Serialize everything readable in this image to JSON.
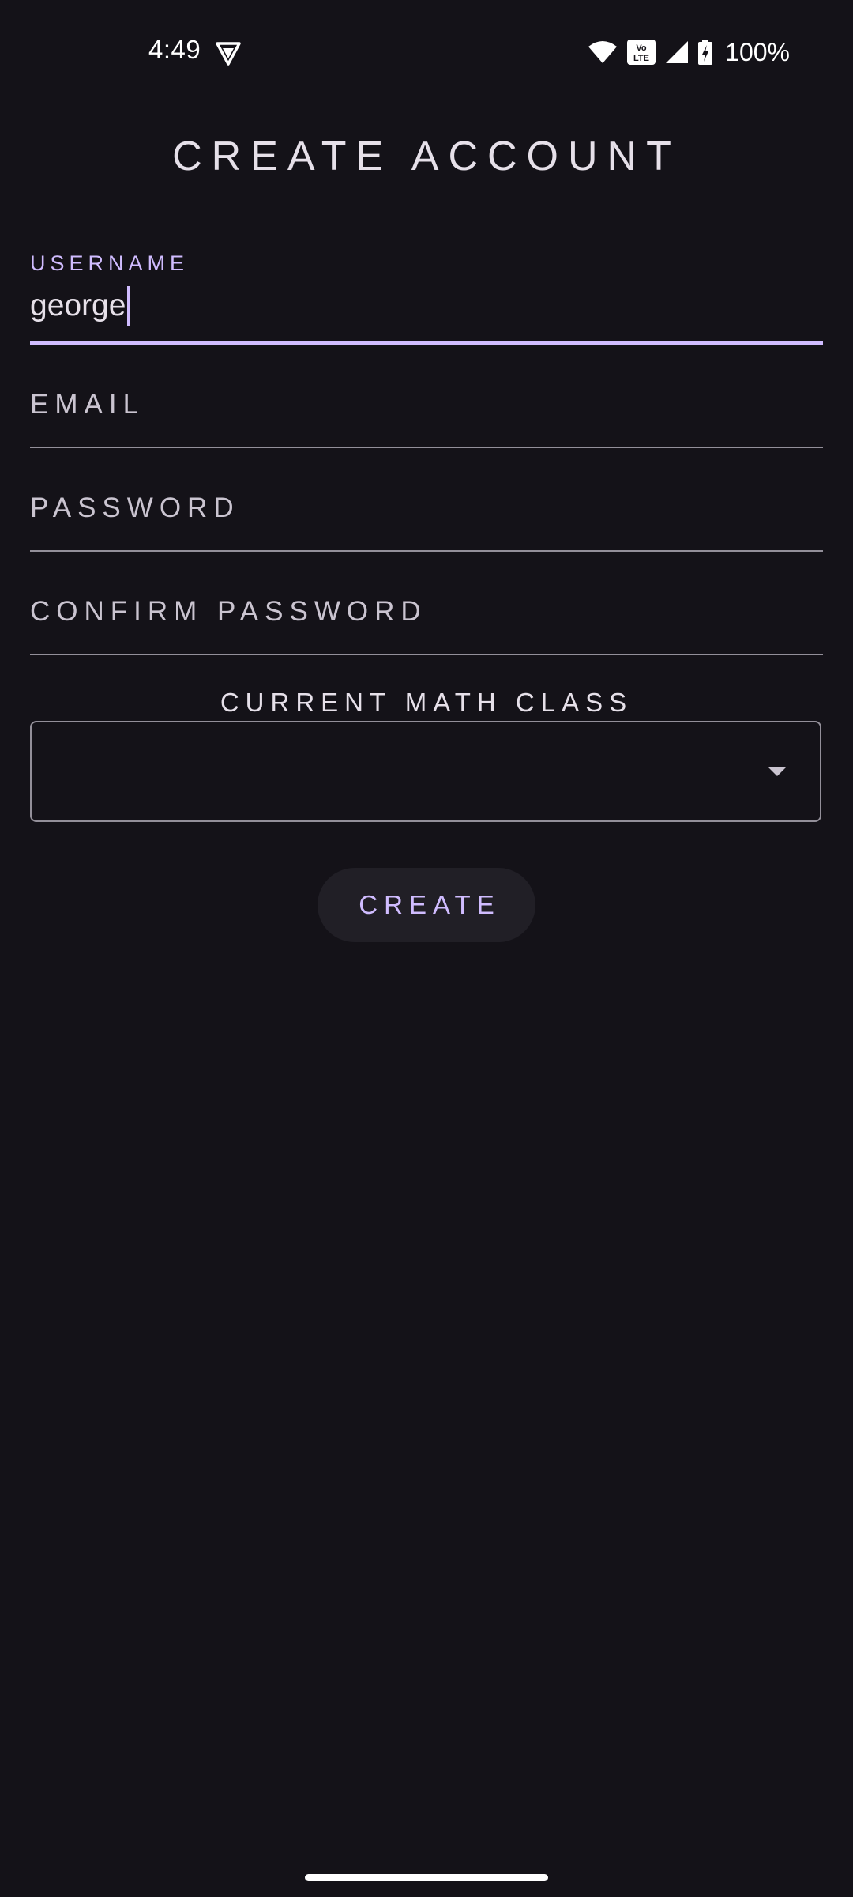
{
  "status_bar": {
    "time": "4:49",
    "battery": "100%",
    "icons": [
      "vpn-shield-icon",
      "wifi-icon",
      "volte-icon",
      "cell-signal-icon",
      "battery-charging-icon"
    ],
    "volte_top": "Vo",
    "volte_bottom": "LTE"
  },
  "page": {
    "title": "CREATE ACCOUNT"
  },
  "form": {
    "username": {
      "label": "USERNAME",
      "value": "george"
    },
    "email": {
      "label": "EMAIL",
      "value": ""
    },
    "password": {
      "label": "PASSWORD",
      "value": ""
    },
    "confirm_password": {
      "label": "CONFIRM PASSWORD",
      "value": ""
    },
    "math_class": {
      "label": "CURRENT MATH CLASS",
      "selected": ""
    },
    "submit_label": "CREATE"
  },
  "colors": {
    "background": "#141218",
    "accent": "#d0bcff",
    "outline": "#938f99",
    "text": "#e6e0e9",
    "button_bg": "#211f26"
  }
}
